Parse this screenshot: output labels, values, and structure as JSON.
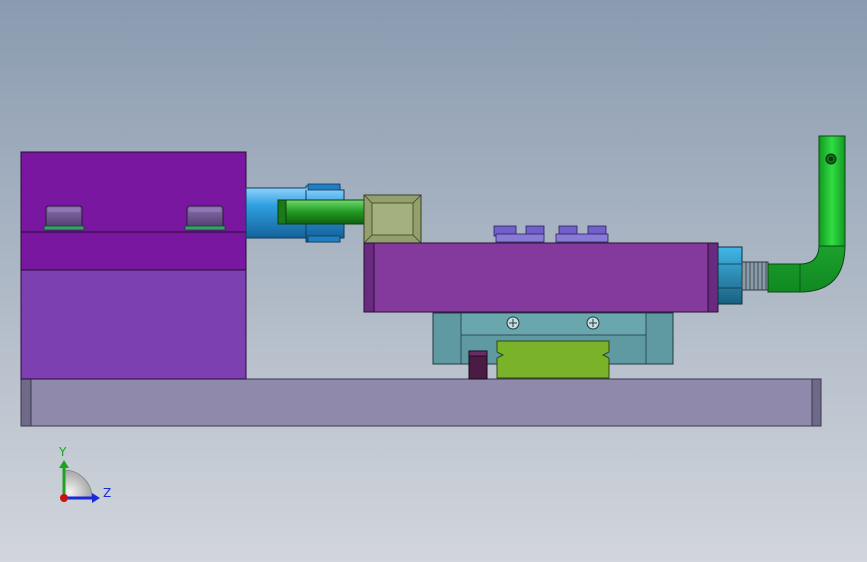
{
  "viewport": {
    "background_top": "#8a9bb0",
    "background_bottom": "#d2d6dc"
  },
  "parts": {
    "base_plate": "#8f8aab",
    "fixed_block_upper": "#7a17a0",
    "fixed_block_lower": "#7c40b0",
    "pressure_pad": "#6a4f88",
    "cylinder_body": "#2f9fe0",
    "piston_rod": "#229922",
    "rod_clevis": "#93a06e",
    "moving_block": "#843a9c",
    "carriage": "#5f9aa2",
    "guide_rail": "#7ab32a",
    "stop_pin": "#4a1b45",
    "hex_nut": "#2a80a8",
    "handle": "#22bb33",
    "top_screws": "#7060c8"
  },
  "triad": {
    "y_label": "Y",
    "z_label": "Z",
    "y_color": "#1ea31e",
    "z_color": "#1a2ad6",
    "x_color": "#cc1111"
  }
}
